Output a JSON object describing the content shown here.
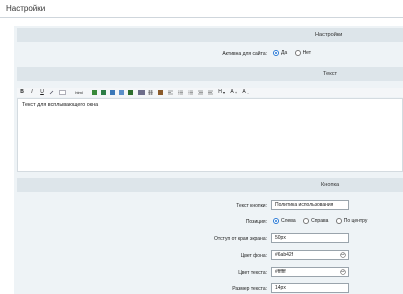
{
  "page": {
    "title": "Настройки"
  },
  "settings": {
    "header": "Настройки",
    "active_label": "Активна для сайта:",
    "active_options": [
      "Да",
      "Нет"
    ],
    "active_selected": "Да"
  },
  "text_section": {
    "header": "Текст",
    "toolbar": {
      "bold": "B",
      "italic": "I",
      "underline": "U",
      "html": "html",
      "h_label": "H",
      "a_plus": "A",
      "a_minus": "A"
    },
    "editor_content": "Текст для всплывающего окна"
  },
  "button_section": {
    "header": "Кнопка",
    "text_label": "Текст кнопки:",
    "text_value": "Политика использования",
    "position_label": "Позиция:",
    "position_options": [
      "Слева",
      "Справа",
      "По центру"
    ],
    "position_selected": "Слева",
    "offset_label": "Отступ от края экрана:",
    "offset_value": "50px",
    "bg_label": "Цвет фона:",
    "bg_value": "#6ab42f",
    "text_color_label": "Цвет текста:",
    "text_color_value": "#ffffff",
    "font_size_label": "Размер текста:",
    "font_size_value": "14px"
  },
  "icons": [
    "link-icon",
    "image-icon",
    "table-icon",
    "list-icon",
    "align-icon",
    "color-picker-icon"
  ]
}
